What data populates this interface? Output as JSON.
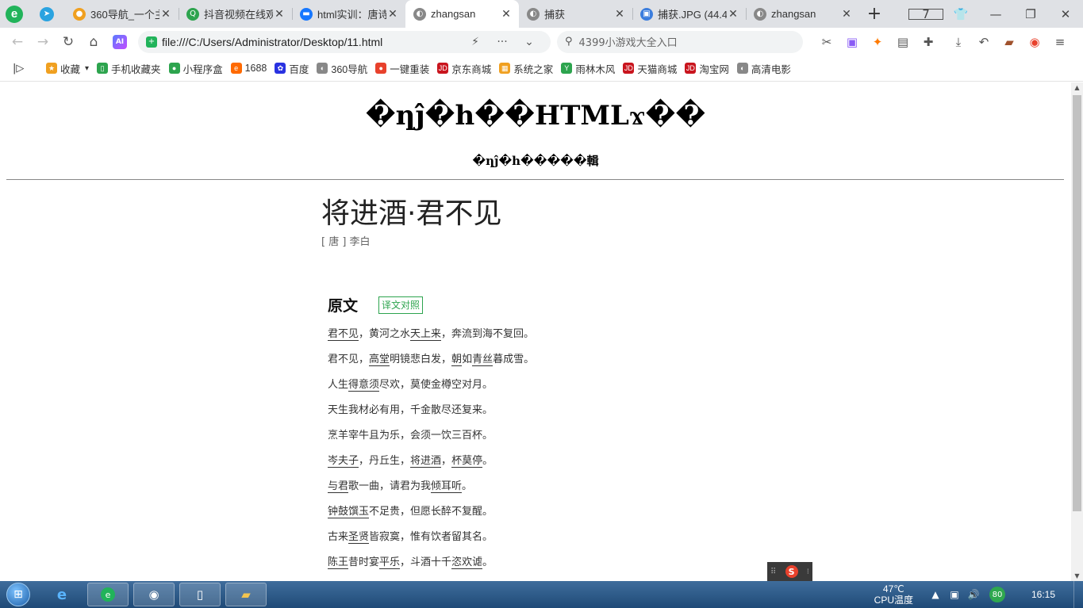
{
  "tabs": [
    {
      "title": "360导航_一个主",
      "color": "#f0a020",
      "glyph": "●",
      "active": false
    },
    {
      "title": "抖音视频在线观",
      "color": "#2da44e",
      "glyph": "Q",
      "active": false
    },
    {
      "title": "html实训：唐诗",
      "color": "#1677ff",
      "glyph": "▬",
      "active": false
    },
    {
      "title": "zhangsan",
      "color": "#888888",
      "glyph": "◐",
      "active": true
    },
    {
      "title": "捕获",
      "color": "#888888",
      "glyph": "◐",
      "active": false
    },
    {
      "title": "捕获.JPG (44.4",
      "color": "#3b7ddd",
      "glyph": "▣",
      "active": false
    },
    {
      "title": "zhangsan",
      "color": "#888888",
      "glyph": "◐",
      "active": false
    }
  ],
  "tab_close": "✕",
  "new_tab": "+",
  "window_counter": "7",
  "address": {
    "url": "file:///C:/Users/Administrator/Desktop/11.html",
    "ai_label": "AI",
    "search_placeholder": "4399小游戏大全入口"
  },
  "bookmarks": [
    {
      "label": "收藏",
      "color": "#f0a020",
      "glyph": "★"
    },
    {
      "label": "手机收藏夹",
      "color": "#2da44e",
      "glyph": "▯"
    },
    {
      "label": "小程序盒",
      "color": "#2da44e",
      "glyph": "●"
    },
    {
      "label": "1688",
      "color": "#ff6a00",
      "glyph": "e"
    },
    {
      "label": "百度",
      "color": "#2932e1",
      "glyph": "✿"
    },
    {
      "label": "360导航",
      "color": "#888888",
      "glyph": "◐"
    },
    {
      "label": "一键重装",
      "color": "#e8412c",
      "glyph": "●"
    },
    {
      "label": "京东商城",
      "color": "#c9151e",
      "glyph": "JD"
    },
    {
      "label": "系统之家",
      "color": "#f0a020",
      "glyph": "▦"
    },
    {
      "label": "雨林木风",
      "color": "#2da44e",
      "glyph": "Y"
    },
    {
      "label": "天猫商城",
      "color": "#c9151e",
      "glyph": "JD"
    },
    {
      "label": "淘宝网",
      "color": "#c9151e",
      "glyph": "JD"
    },
    {
      "label": "高清电影",
      "color": "#888888",
      "glyph": "◐"
    }
  ],
  "page": {
    "site_title": "�ƞĵ�h��HTMLϫ��",
    "site_subtitle": "�ƞĵ�h�����輯",
    "poem_title": "将进酒·君不见",
    "poem_author": "[ 唐 ] 李白",
    "section_label": "原文",
    "compare_button": "译文对照",
    "lines": [
      [
        {
          "t": "君不见",
          "u": true
        },
        {
          "t": "，黄河之水",
          "u": false
        },
        {
          "t": "天上来",
          "u": true
        },
        {
          "t": "，奔流到海不复回。",
          "u": false
        }
      ],
      [
        {
          "t": "君不见，",
          "u": false
        },
        {
          "t": "高堂",
          "u": true
        },
        {
          "t": "明镜悲白发，",
          "u": false
        },
        {
          "t": "朝",
          "u": true
        },
        {
          "t": "如",
          "u": false
        },
        {
          "t": "青丝",
          "u": true
        },
        {
          "t": "暮成雪。",
          "u": false
        }
      ],
      [
        {
          "t": "人生",
          "u": false
        },
        {
          "t": "得意须",
          "u": true
        },
        {
          "t": "尽欢，莫使金樽空对月。",
          "u": false
        }
      ],
      [
        {
          "t": "天生我材必有用，千金散尽还复来。",
          "u": false
        }
      ],
      [
        {
          "t": "烹羊宰牛且为乐，会须一饮三百杯。",
          "u": false
        }
      ],
      [
        {
          "t": "岑夫子",
          "u": true
        },
        {
          "t": "，丹丘生，",
          "u": false
        },
        {
          "t": "将进酒",
          "u": true
        },
        {
          "t": "，",
          "u": false
        },
        {
          "t": "杯莫停",
          "u": true
        },
        {
          "t": "。",
          "u": false
        }
      ],
      [
        {
          "t": "与君",
          "u": true
        },
        {
          "t": "歌一曲，请君为我",
          "u": false
        },
        {
          "t": "倾耳听",
          "u": true
        },
        {
          "t": "。",
          "u": false
        }
      ],
      [
        {
          "t": "钟鼓馔玉",
          "u": true
        },
        {
          "t": "不足贵，但愿长醉不复醒。",
          "u": false
        }
      ],
      [
        {
          "t": "古来",
          "u": false
        },
        {
          "t": "圣贤",
          "u": true
        },
        {
          "t": "皆寂寞，惟有饮者留其名。",
          "u": false
        }
      ],
      [
        {
          "t": "陈王",
          "u": true
        },
        {
          "t": "昔时宴",
          "u": false
        },
        {
          "t": "平乐",
          "u": true
        },
        {
          "t": "，斗酒十千",
          "u": false
        },
        {
          "t": "恣欢谑",
          "u": true
        },
        {
          "t": "。",
          "u": false
        }
      ]
    ]
  },
  "ime": {
    "glyph": "S"
  },
  "taskbar": {
    "temp": "47℃",
    "temp_label": "CPU温度",
    "badge": "80",
    "time": "16:15"
  }
}
